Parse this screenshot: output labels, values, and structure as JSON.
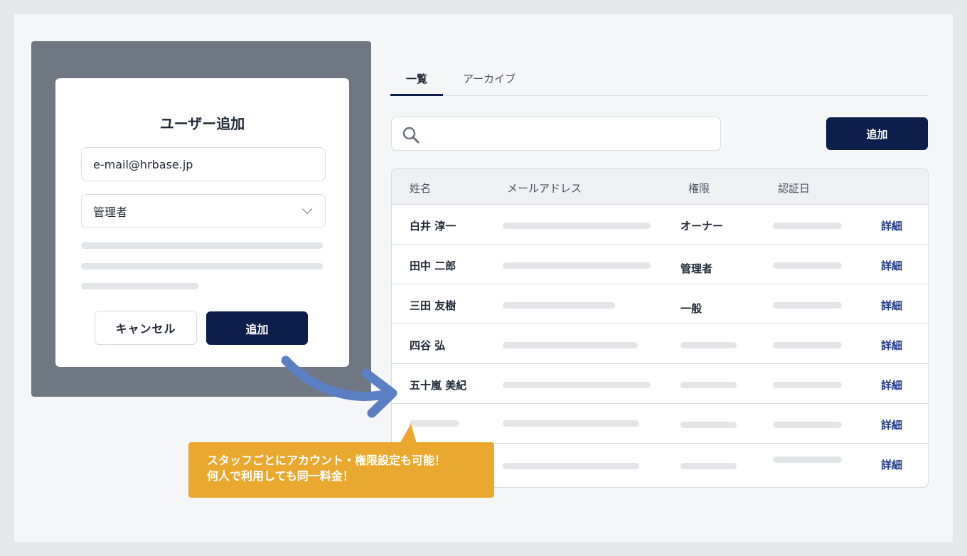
{
  "modal": {
    "title": "ユーザー追加",
    "email_value": "e-mail@hrbase.jp",
    "role_value": "管理者",
    "cancel_label": "キャンセル",
    "add_label": "追加"
  },
  "tabs": [
    {
      "label": "一覧",
      "active": true
    },
    {
      "label": "アーカイブ",
      "active": false
    }
  ],
  "toolbar": {
    "search_value": "",
    "add_label": "追加"
  },
  "table": {
    "headers": [
      "姓名",
      "メールアドレス",
      "権限",
      "認証日"
    ],
    "rows": [
      {
        "name": "白井 淳一",
        "role": "オーナー",
        "detail": "詳細"
      },
      {
        "name": "田中 二郎",
        "role": "管理者",
        "detail": "詳細"
      },
      {
        "name": "三田 友樹",
        "role": "一般",
        "detail": "詳細"
      },
      {
        "name": "四谷 弘",
        "role": "",
        "detail": "詳細"
      },
      {
        "name": "五十嵐 美紀",
        "role": "",
        "detail": "詳細"
      },
      {
        "name": "",
        "role": "",
        "detail": "詳細"
      },
      {
        "name": "",
        "role": "",
        "detail": "詳細"
      }
    ]
  },
  "callout": {
    "line1": "スタッフごとにアカウント・権限設定も可能！",
    "line2": "何人で利用しても同一料金！"
  },
  "colors": {
    "primary": "#0c1f4a",
    "accent": "#eaa92e",
    "arrow": "#5b7fc4",
    "link": "#1e3a8a"
  },
  "icons": {
    "search": "search-icon",
    "chevron": "chevron-down-icon"
  }
}
